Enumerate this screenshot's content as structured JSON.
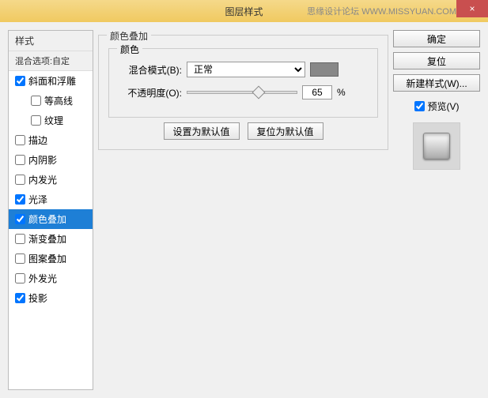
{
  "titlebar": {
    "title": "图层样式",
    "watermark": "思缘设计论坛 WWW.MISSYUAN.COM",
    "close": "×"
  },
  "left": {
    "header": "样式",
    "sub": "混合选项:自定",
    "items": [
      {
        "label": "斜面和浮雕",
        "checked": true,
        "indent": false
      },
      {
        "label": "等高线",
        "checked": false,
        "indent": true
      },
      {
        "label": "纹理",
        "checked": false,
        "indent": true
      },
      {
        "label": "描边",
        "checked": false,
        "indent": false
      },
      {
        "label": "内阴影",
        "checked": false,
        "indent": false
      },
      {
        "label": "内发光",
        "checked": false,
        "indent": false
      },
      {
        "label": "光泽",
        "checked": true,
        "indent": false
      },
      {
        "label": "颜色叠加",
        "checked": true,
        "indent": false,
        "selected": true
      },
      {
        "label": "渐变叠加",
        "checked": false,
        "indent": false
      },
      {
        "label": "图案叠加",
        "checked": false,
        "indent": false
      },
      {
        "label": "外发光",
        "checked": false,
        "indent": false
      },
      {
        "label": "投影",
        "checked": true,
        "indent": false
      }
    ]
  },
  "center": {
    "group_title": "颜色叠加",
    "color_group": "颜色",
    "blend_label": "混合模式(B):",
    "blend_value": "正常",
    "opacity_label": "不透明度(O):",
    "opacity_value": "65",
    "opacity_unit": "%",
    "set_default": "设置为默认值",
    "reset_default": "复位为默认值",
    "swatch_color": "#888888"
  },
  "right": {
    "ok": "确定",
    "cancel": "复位",
    "new_style": "新建样式(W)...",
    "preview": "预览(V)"
  }
}
